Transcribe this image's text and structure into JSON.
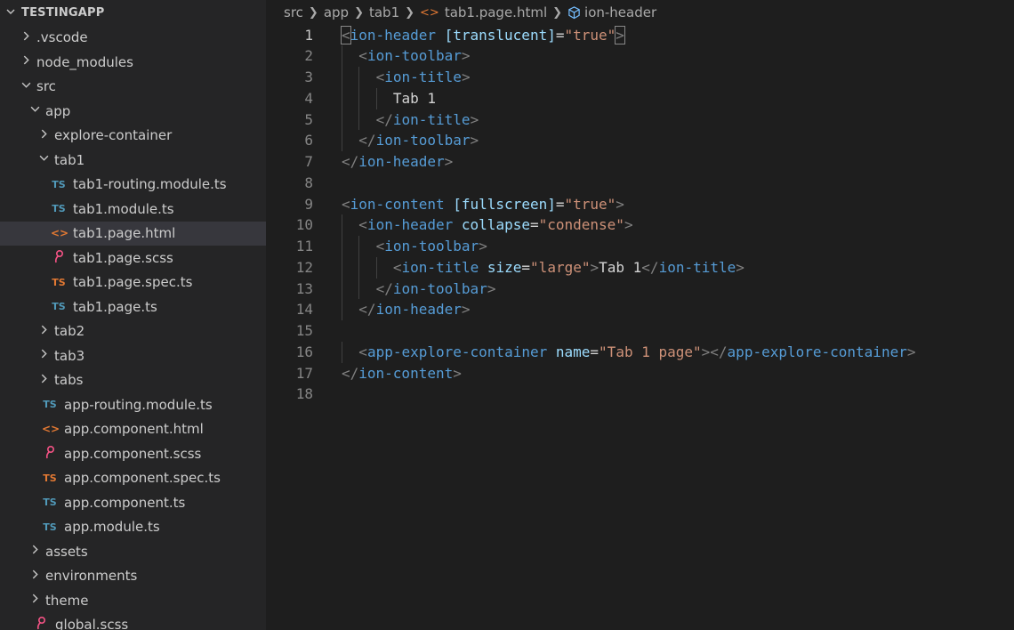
{
  "sidebar": {
    "title": "TESTINGAPP",
    "items": [
      {
        "label": ".vscode",
        "type": "folder",
        "expanded": false,
        "depth": 1
      },
      {
        "label": "node_modules",
        "type": "folder",
        "expanded": false,
        "depth": 1
      },
      {
        "label": "src",
        "type": "folder",
        "expanded": true,
        "depth": 1
      },
      {
        "label": "app",
        "type": "folder",
        "expanded": true,
        "depth": 2
      },
      {
        "label": "explore-container",
        "type": "folder",
        "expanded": false,
        "depth": 3
      },
      {
        "label": "tab1",
        "type": "folder",
        "expanded": true,
        "depth": 3
      },
      {
        "label": "tab1-routing.module.ts",
        "type": "ts",
        "icon_text": "TS",
        "depth": 4
      },
      {
        "label": "tab1.module.ts",
        "type": "ts",
        "icon_text": "TS",
        "depth": 4
      },
      {
        "label": "tab1.page.html",
        "type": "html",
        "icon_text": "<>",
        "depth": 4,
        "selected": true
      },
      {
        "label": "tab1.page.scss",
        "type": "scss",
        "icon_text": "♀",
        "depth": 4
      },
      {
        "label": "tab1.page.spec.ts",
        "type": "spec",
        "icon_text": "TS",
        "depth": 4
      },
      {
        "label": "tab1.page.ts",
        "type": "ts",
        "icon_text": "TS",
        "depth": 4
      },
      {
        "label": "tab2",
        "type": "folder",
        "expanded": false,
        "depth": 3
      },
      {
        "label": "tab3",
        "type": "folder",
        "expanded": false,
        "depth": 3
      },
      {
        "label": "tabs",
        "type": "folder",
        "expanded": false,
        "depth": 3
      },
      {
        "label": "app-routing.module.ts",
        "type": "ts",
        "icon_text": "TS",
        "depth": 3
      },
      {
        "label": "app.component.html",
        "type": "html",
        "icon_text": "<>",
        "depth": 3
      },
      {
        "label": "app.component.scss",
        "type": "scss",
        "icon_text": "♀",
        "depth": 3
      },
      {
        "label": "app.component.spec.ts",
        "type": "spec",
        "icon_text": "TS",
        "depth": 3
      },
      {
        "label": "app.component.ts",
        "type": "ts",
        "icon_text": "TS",
        "depth": 3
      },
      {
        "label": "app.module.ts",
        "type": "ts",
        "icon_text": "TS",
        "depth": 3
      },
      {
        "label": "assets",
        "type": "folder",
        "expanded": false,
        "depth": 2
      },
      {
        "label": "environments",
        "type": "folder",
        "expanded": false,
        "depth": 2
      },
      {
        "label": "theme",
        "type": "folder",
        "expanded": false,
        "depth": 2
      },
      {
        "label": "global.scss",
        "type": "scss",
        "icon_text": "♀",
        "depth": 2
      }
    ]
  },
  "breadcrumb": {
    "parts": [
      "src",
      "app",
      "tab1"
    ],
    "file": "tab1.page.html",
    "symbol": "ion-header"
  },
  "editor": {
    "active_line": 1,
    "lines": [
      {
        "n": "1",
        "indent": 0,
        "tokens": [
          [
            "b",
            "<"
          ],
          [
            "t",
            "ion-header"
          ],
          [
            "p",
            " "
          ],
          [
            "a",
            "[translucent]"
          ],
          [
            "e",
            "="
          ],
          [
            "s",
            "\"true\""
          ],
          [
            "b",
            ">"
          ]
        ]
      },
      {
        "n": "2",
        "indent": 1,
        "tokens": [
          [
            "b",
            "<"
          ],
          [
            "t",
            "ion-toolbar"
          ],
          [
            "b",
            ">"
          ]
        ]
      },
      {
        "n": "3",
        "indent": 2,
        "tokens": [
          [
            "b",
            "<"
          ],
          [
            "t",
            "ion-title"
          ],
          [
            "b",
            ">"
          ]
        ]
      },
      {
        "n": "4",
        "indent": 3,
        "tokens": [
          [
            "p",
            "Tab 1"
          ]
        ]
      },
      {
        "n": "5",
        "indent": 2,
        "tokens": [
          [
            "b",
            "</"
          ],
          [
            "t",
            "ion-title"
          ],
          [
            "b",
            ">"
          ]
        ]
      },
      {
        "n": "6",
        "indent": 1,
        "tokens": [
          [
            "b",
            "</"
          ],
          [
            "t",
            "ion-toolbar"
          ],
          [
            "b",
            ">"
          ]
        ]
      },
      {
        "n": "7",
        "indent": 0,
        "tokens": [
          [
            "b",
            "</"
          ],
          [
            "t",
            "ion-header"
          ],
          [
            "b",
            ">"
          ]
        ]
      },
      {
        "n": "8",
        "indent": 0,
        "tokens": []
      },
      {
        "n": "9",
        "indent": 0,
        "tokens": [
          [
            "b",
            "<"
          ],
          [
            "t",
            "ion-content"
          ],
          [
            "p",
            " "
          ],
          [
            "a",
            "[fullscreen]"
          ],
          [
            "e",
            "="
          ],
          [
            "s",
            "\"true\""
          ],
          [
            "b",
            ">"
          ]
        ]
      },
      {
        "n": "10",
        "indent": 1,
        "tokens": [
          [
            "b",
            "<"
          ],
          [
            "t",
            "ion-header"
          ],
          [
            "p",
            " "
          ],
          [
            "a",
            "collapse"
          ],
          [
            "e",
            "="
          ],
          [
            "s",
            "\"condense\""
          ],
          [
            "b",
            ">"
          ]
        ]
      },
      {
        "n": "11",
        "indent": 2,
        "tokens": [
          [
            "b",
            "<"
          ],
          [
            "t",
            "ion-toolbar"
          ],
          [
            "b",
            ">"
          ]
        ]
      },
      {
        "n": "12",
        "indent": 3,
        "tokens": [
          [
            "b",
            "<"
          ],
          [
            "t",
            "ion-title"
          ],
          [
            "p",
            " "
          ],
          [
            "a",
            "size"
          ],
          [
            "e",
            "="
          ],
          [
            "s",
            "\"large\""
          ],
          [
            "b",
            ">"
          ],
          [
            "p",
            "Tab 1"
          ],
          [
            "b",
            "</"
          ],
          [
            "t",
            "ion-title"
          ],
          [
            "b",
            ">"
          ]
        ]
      },
      {
        "n": "13",
        "indent": 2,
        "tokens": [
          [
            "b",
            "</"
          ],
          [
            "t",
            "ion-toolbar"
          ],
          [
            "b",
            ">"
          ]
        ]
      },
      {
        "n": "14",
        "indent": 1,
        "tokens": [
          [
            "b",
            "</"
          ],
          [
            "t",
            "ion-header"
          ],
          [
            "b",
            ">"
          ]
        ]
      },
      {
        "n": "15",
        "indent": 0,
        "tokens": []
      },
      {
        "n": "16",
        "indent": 1,
        "tokens": [
          [
            "b",
            "<"
          ],
          [
            "t",
            "app-explore-container"
          ],
          [
            "p",
            " "
          ],
          [
            "a",
            "name"
          ],
          [
            "e",
            "="
          ],
          [
            "s",
            "\"Tab 1 page\""
          ],
          [
            "b",
            "></"
          ],
          [
            "t",
            "app-explore-container"
          ],
          [
            "b",
            ">"
          ]
        ]
      },
      {
        "n": "17",
        "indent": 0,
        "tokens": [
          [
            "b",
            "</"
          ],
          [
            "t",
            "ion-content"
          ],
          [
            "b",
            ">"
          ]
        ]
      },
      {
        "n": "18",
        "indent": 0,
        "tokens": []
      }
    ]
  },
  "colors": {
    "sidebar_bg": "#252526",
    "editor_bg": "#1e1e1e",
    "selected_row": "#37373d",
    "tag": "#569cd6",
    "attr": "#9cdcfe",
    "string": "#ce9178"
  }
}
